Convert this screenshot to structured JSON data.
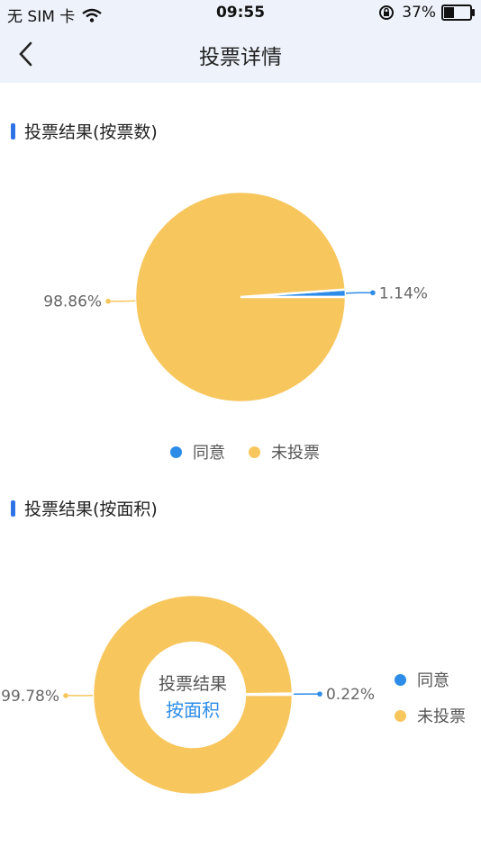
{
  "status_bar": {
    "carrier": "无 SIM 卡",
    "time": "09:55",
    "battery_percent": "37%",
    "battery_level": 0.37
  },
  "header": {
    "title": "投票详情"
  },
  "colors": {
    "agree": "#2d8ce8",
    "not_voted": "#f7c65d",
    "accent": "#2f72e6"
  },
  "sections": [
    {
      "title": "投票结果(按票数)"
    },
    {
      "title": "投票结果(按面积)"
    }
  ],
  "chart_data": [
    {
      "type": "pie",
      "categories": [
        "同意",
        "未投票"
      ],
      "values": [
        1.14,
        98.86
      ],
      "labels": [
        "1.14%",
        "98.86%"
      ],
      "legend": [
        "同意",
        "未投票"
      ],
      "legend_position": "bottom"
    },
    {
      "type": "pie",
      "donut": true,
      "categories": [
        "同意",
        "未投票"
      ],
      "values": [
        0.22,
        99.78
      ],
      "labels": [
        "0.22%",
        "99.78%"
      ],
      "center_text": [
        "投票结果",
        "按面积"
      ],
      "legend": [
        "同意",
        "未投票"
      ],
      "legend_position": "right"
    }
  ]
}
